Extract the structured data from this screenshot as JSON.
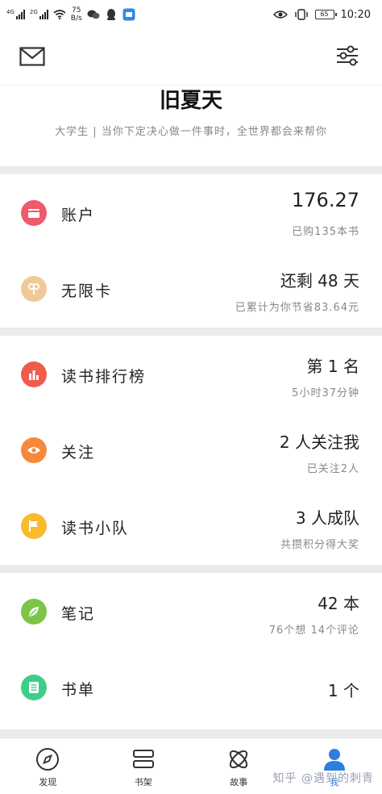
{
  "status_bar": {
    "signal1": "4G",
    "signal2": "2G",
    "net_speed_value": "75",
    "net_speed_unit": "B/s",
    "battery": "65",
    "time": "10:20"
  },
  "header": {
    "mail_icon": "mail-icon",
    "filter_icon": "sliders-icon"
  },
  "profile": {
    "name": "旧夏天",
    "tagline": "大学生 | 当你下定决心做一件事时，全世界都会来帮你"
  },
  "sections": {
    "account": {
      "label": "账户",
      "value": "176.27",
      "sub": "已购135本书",
      "color": "#ee5b6b"
    },
    "unlimited": {
      "label": "无限卡",
      "value": "还剩 48 天",
      "sub": "已累计为你节省83.64元",
      "color": "#f0c997"
    },
    "ranking": {
      "label": "读书排行榜",
      "value": "第 1 名",
      "sub": "5小时37分钟",
      "color": "#ef5c4c"
    },
    "follow": {
      "label": "关注",
      "value": "2 人关注我",
      "sub": "已关注2人",
      "color": "#f5893b"
    },
    "team": {
      "label": "读书小队",
      "value": "3 人成队",
      "sub": "共攒积分得大奖",
      "color": "#f8bb2c"
    },
    "notes": {
      "label": "笔记",
      "value": "42 本",
      "sub": "76个想 14个评论",
      "color": "#7cc546"
    },
    "booklist": {
      "label": "书单",
      "value": "1 个",
      "color": "#3dcf8a"
    }
  },
  "bottom_nav": [
    {
      "label": "发现",
      "icon": "compass-icon"
    },
    {
      "label": "书架",
      "icon": "bookshelf-icon"
    },
    {
      "label": "故事",
      "icon": "story-icon"
    },
    {
      "label": "我",
      "icon": "profile-icon",
      "active": true
    }
  ],
  "watermark": "知乎 @遇到的刺青",
  "colors": {
    "accent": "#2f7de1",
    "divider": "#ebebeb"
  }
}
